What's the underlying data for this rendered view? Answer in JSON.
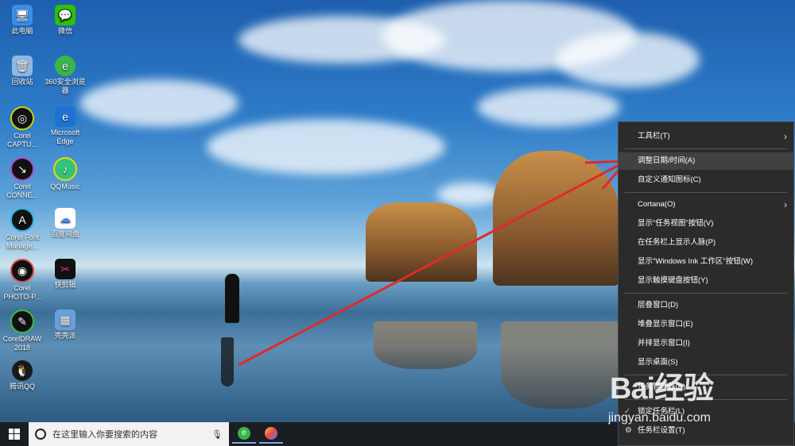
{
  "desktop_icons": [
    {
      "label": "此电脑",
      "icon": "computer-icon",
      "color": "#3a8ee6"
    },
    {
      "label": "回收站",
      "icon": "recycle-bin-icon",
      "color": "#8fb7e0"
    },
    {
      "label": "Corel CAPTU...",
      "icon": "corel-capture-icon",
      "color": "#111111"
    },
    {
      "label": "Corel CONNE...",
      "icon": "corel-connect-icon",
      "color": "#111111"
    },
    {
      "label": "Corel Font Manage...",
      "icon": "corel-font-icon",
      "color": "#111111"
    },
    {
      "label": "Corel PHOTO-P...",
      "icon": "corel-photo-icon",
      "color": "#111111"
    },
    {
      "label": "CorelDRAW 2018",
      "icon": "coreldraw-icon",
      "color": "#111111"
    },
    {
      "label": "腾讯QQ",
      "icon": "qq-icon",
      "color": "#1a1a1a"
    },
    {
      "label": "微信",
      "icon": "wechat-icon",
      "color": "#2dc100"
    },
    {
      "label": "360安全浏览器",
      "icon": "360-browser-icon",
      "color": "#3bb54a"
    },
    {
      "label": "Microsoft Edge",
      "icon": "edge-icon",
      "color": "#1e73d2"
    },
    {
      "label": "QQMusic",
      "icon": "qqmusic-icon",
      "color": "#31c27c"
    },
    {
      "label": "百度网盘",
      "icon": "baidu-netdisk-icon",
      "color": "#3d8af7"
    },
    {
      "label": "快剪辑",
      "icon": "kuaijianji-icon",
      "color": "#111111"
    },
    {
      "label": "壳壳派",
      "icon": "keke-icon",
      "color": "#6aa0d8"
    }
  ],
  "taskbar": {
    "search_placeholder": "在这里输入你要搜索的内容",
    "apps": [
      "360-browser-icon",
      "paint-icon"
    ]
  },
  "context_menu": {
    "items": [
      {
        "label": "工具栏(T)",
        "submenu": true
      },
      {
        "label": "调整日期/时间(A)",
        "highlighted": true
      },
      {
        "label": "自定义通知图标(C)"
      },
      {
        "label": "Cortana(O)",
        "submenu": true
      },
      {
        "label": "显示\"任务视图\"按钮(V)"
      },
      {
        "label": "在任务栏上显示人脉(P)"
      },
      {
        "label": "显示\"Windows Ink 工作区\"按钮(W)"
      },
      {
        "label": "显示触摸键盘按钮(Y)"
      },
      {
        "label": "层叠窗口(D)"
      },
      {
        "label": "堆叠显示窗口(E)"
      },
      {
        "label": "并排显示窗口(I)"
      },
      {
        "label": "显示桌面(S)"
      },
      {
        "label": "任务管理器(K)"
      },
      {
        "label": "锁定任务栏(L)",
        "checked": true
      },
      {
        "label": "任务栏设置(T)",
        "gear": true
      }
    ]
  },
  "watermark": {
    "brand": "Bai经验",
    "url": "jingyan.baidu.com"
  },
  "annotation_color": "#e02a2a"
}
